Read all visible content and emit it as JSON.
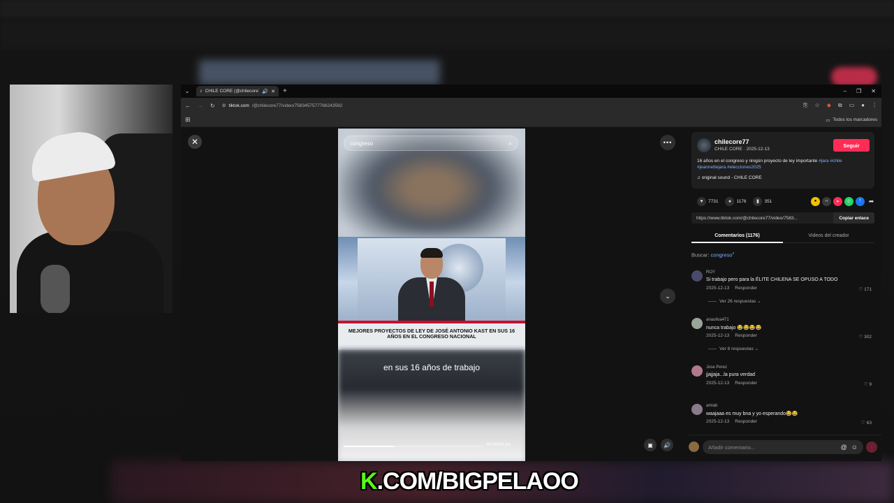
{
  "browser": {
    "tab_title": "CHILE CORE (@chilecore77",
    "url_host": "tiktok.com",
    "url_path": "/@chilecore77/video/7583457577766243592",
    "bookmarks_label": "Todos los marcadores"
  },
  "video": {
    "search_query": "congreso",
    "lower_third": "MEJORES PROYECTOS DE LEY DE JOSÉ ANTONIO KAST EN SUS 16 AÑOS EN EL CONGRESO NACIONAL",
    "subtitle": "en sus 16 años de trabajo",
    "time": "00:05/00:14",
    "progress_fraction": 0.36
  },
  "post": {
    "username": "chilecore77",
    "meta": "CHILE CORE · 2025-12-13",
    "follow_label": "Seguir",
    "description": "16 años en el congreso y ningún proyecto de ley importante",
    "tags_line1": "#jara #chile",
    "tags_line2": "#jeannettejara #elecciones2025",
    "sound": "original sound - CHILE CORE",
    "likes": "7731",
    "comments_count": "1176",
    "saves": "351",
    "link": "https://www.tiktok.com/@chilecore77/video/7583...",
    "copy_label": "Copiar enlace"
  },
  "tabs": {
    "comments": "Comentarios (1176)",
    "creator": "Videos del creador"
  },
  "search": {
    "label": "Buscar:",
    "query": "congreso"
  },
  "comments": [
    {
      "user": "ROY",
      "text": "Si trabajo pero para la ÉLITE CHILENA SE OPUSO A TODO",
      "date": "2025-12-13",
      "reply": "Responder",
      "likes": "171",
      "replies": "Ver 26 respuestas",
      "avatar_color": "#4a4a6a"
    },
    {
      "user": "anaulloa471",
      "text": "nunca trabajo 😂😂😂😂",
      "date": "2025-12-13",
      "reply": "Responder",
      "likes": "302",
      "replies": "Ver 8 respuestas",
      "avatar_color": "#9aa59a"
    },
    {
      "user": "Jose Perez",
      "text": "jjajjaja...la pura verdad",
      "date": "2025-12-13",
      "reply": "Responder",
      "likes": "9",
      "replies": "",
      "avatar_color": "#b07a8a"
    },
    {
      "user": "amiab",
      "text": "waajaaa es muy bna y yo esperando😂😂",
      "date": "2025-12-13",
      "reply": "Responder",
      "likes": "63",
      "replies": "",
      "avatar_color": "#8a7a8a"
    }
  ],
  "composer": {
    "placeholder": "Añadir comentario..."
  },
  "brand": {
    "k": "K",
    "rest": ".COM/BIGPELAOO"
  }
}
